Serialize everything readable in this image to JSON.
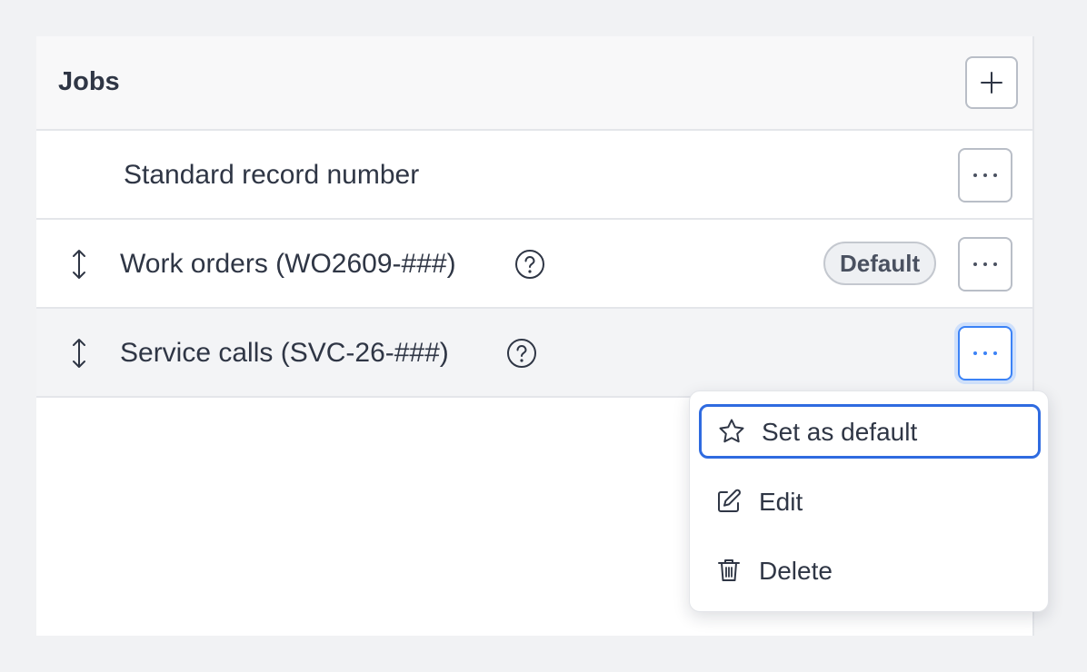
{
  "panel": {
    "title": "Jobs"
  },
  "rows": [
    {
      "label": "Standard record number",
      "has_drag": false,
      "has_help": false,
      "badge": null
    },
    {
      "label": "Work orders (WO2609-###)",
      "has_drag": true,
      "has_help": true,
      "badge": "Default"
    },
    {
      "label": "Service calls (SVC-26-###)",
      "has_drag": true,
      "has_help": true,
      "badge": null
    }
  ],
  "menu": {
    "items": [
      {
        "label": "Set as default",
        "icon": "star-icon"
      },
      {
        "label": "Edit",
        "icon": "edit-icon"
      },
      {
        "label": "Delete",
        "icon": "trash-icon"
      }
    ]
  },
  "colors": {
    "accent": "#2f6be0",
    "focus_ring": "#3b82f6",
    "text": "#2f3645"
  },
  "icons": {
    "add": "plus-icon",
    "more": "more-horizontal-icon",
    "drag": "drag-vertical-icon",
    "help": "question-circle-icon"
  }
}
